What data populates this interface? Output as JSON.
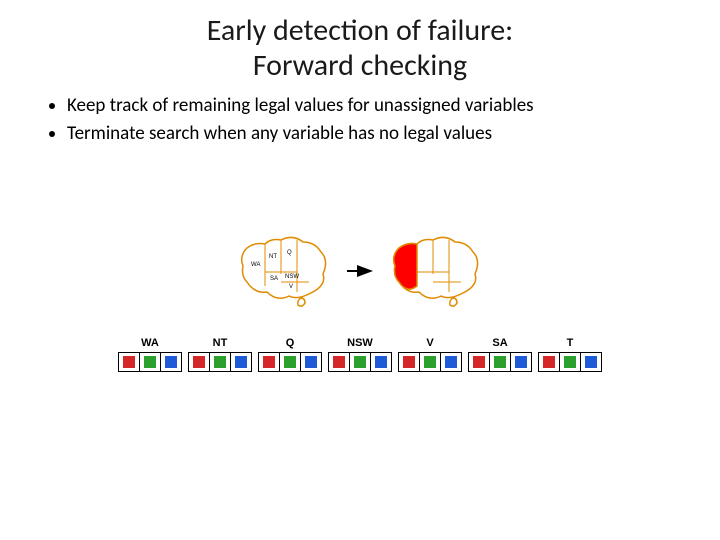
{
  "title_line1": "Early detection of failure:",
  "title_line2": "Forward checking",
  "bullets": [
    "Keep track of remaining legal values for unassigned variables",
    "Terminate search when any variable has no legal values"
  ],
  "map_regions": [
    "WA",
    "NT",
    "Q",
    "SA",
    "NSW",
    "V"
  ],
  "domain_vars": [
    "WA",
    "NT",
    "Q",
    "NSW",
    "V",
    "SA",
    "T"
  ],
  "domain_state": [
    [
      "red",
      "green",
      "blue"
    ],
    [
      "red",
      "green",
      "blue"
    ],
    [
      "red",
      "green",
      "blue"
    ],
    [
      "red",
      "green",
      "blue"
    ],
    [
      "red",
      "green",
      "blue"
    ],
    [
      "red",
      "green",
      "blue"
    ],
    [
      "red",
      "green",
      "blue"
    ]
  ],
  "colors": {
    "map_outline": "#e08b00",
    "map_fill": "#ffffff",
    "map_sel_fill": "#ff0000",
    "arrow": "#000000"
  }
}
